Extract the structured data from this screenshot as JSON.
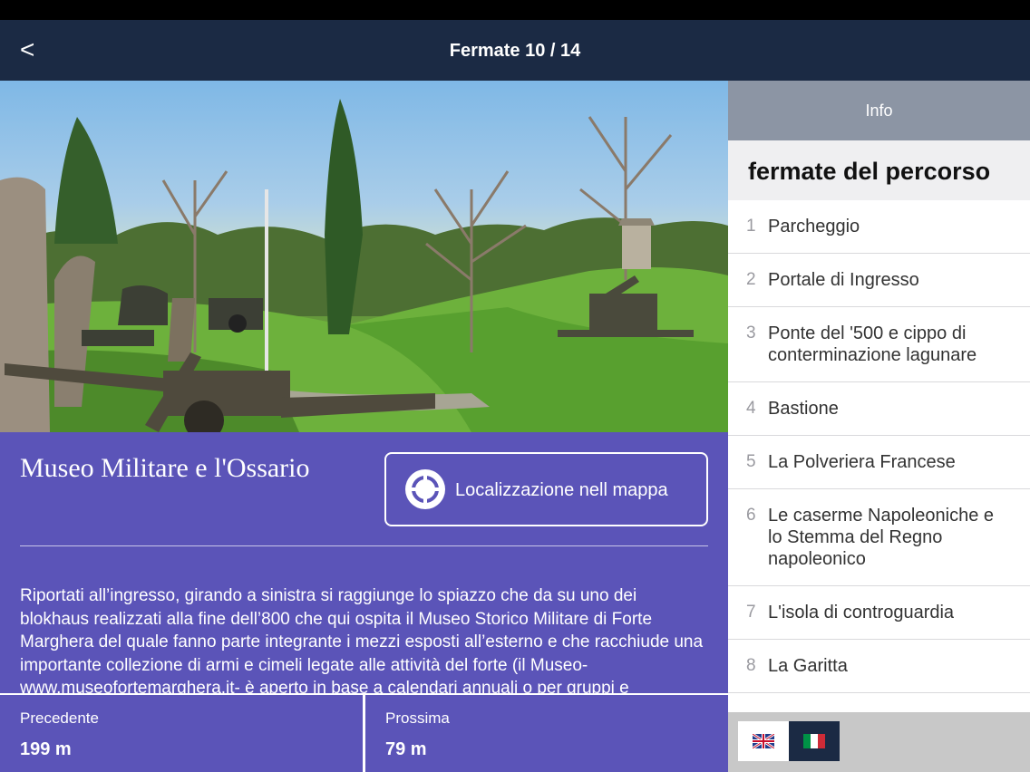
{
  "nav": {
    "back_label": "<",
    "title": "Fermate 10 / 14"
  },
  "poi": {
    "title": "Museo Militare e l'Ossario",
    "map_button_label": "Localizzazione nell mappa",
    "description": "Riportati all’ingresso, girando a sinistra si raggiunge lo spiazzo che da su uno dei blokhaus realizzati alla fine dell’800 che qui ospita il Museo Storico Militare di Forte Marghera del quale fanno parte integrante i mezzi esposti all’esterno e che racchiude una importante collezione di armi e cimeli legate alle attività del forte (il Museo- www.museofortemarghera.it- è aperto in base a calendari annuali o per gruppi e"
  },
  "footer": {
    "previous_label": "Precedente",
    "previous_distance": "199 m",
    "next_label": "Prossima",
    "next_distance": "79 m"
  },
  "side": {
    "info_label": "Info",
    "route_title": "fermate del percorso",
    "stops": [
      {
        "num": "1",
        "name": "Parcheggio"
      },
      {
        "num": "2",
        "name": "Portale di Ingresso"
      },
      {
        "num": "3",
        "name": "Ponte del '500 e cippo di conterminazione lagunare"
      },
      {
        "num": "4",
        "name": "Bastione"
      },
      {
        "num": "5",
        "name": "La Polveriera Francese"
      },
      {
        "num": "6",
        "name": "Le caserme Napoleoniche e lo Stemma del Regno napoleonico"
      },
      {
        "num": "7",
        "name": "L'isola di controguardia"
      },
      {
        "num": "8",
        "name": "La Garitta"
      }
    ]
  },
  "languages": [
    {
      "code": "en",
      "icon": "uk-flag-icon"
    },
    {
      "code": "it",
      "icon": "italy-flag-icon",
      "selected": true
    }
  ],
  "colors": {
    "nav_bg": "#1b2a44",
    "content_bg": "#5b54b8",
    "info_header_bg": "#8c95a4"
  }
}
